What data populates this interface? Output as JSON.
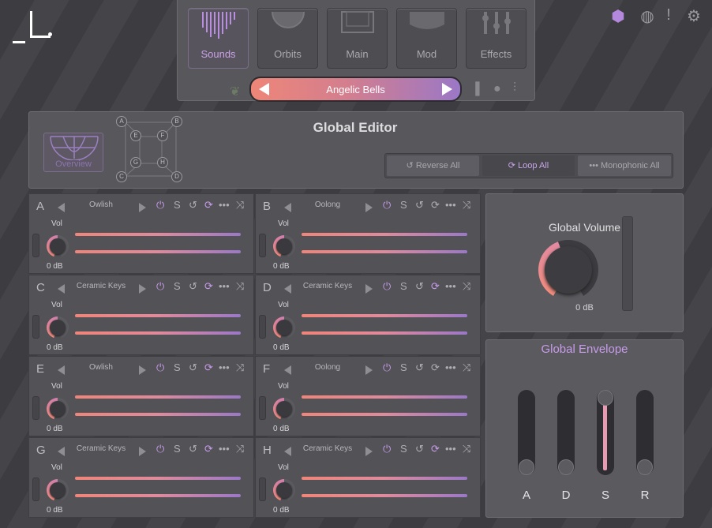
{
  "nav": {
    "tabs": [
      {
        "label": "Sounds",
        "active": true
      },
      {
        "label": "Orbits",
        "active": false
      },
      {
        "label": "Main",
        "active": false
      },
      {
        "label": "Mod",
        "active": false
      },
      {
        "label": "Effects",
        "active": false
      }
    ]
  },
  "preset": {
    "name": "Angelic Bells"
  },
  "top_icons": [
    "cube-icon",
    "globe-icon",
    "alert-icon",
    "gear-icon"
  ],
  "global_editor": {
    "title": "Global Editor",
    "overview_label": "Overview",
    "nodes": [
      "A",
      "B",
      "C",
      "D",
      "E",
      "F",
      "G",
      "H"
    ],
    "toggles": [
      {
        "label": "Reverse All",
        "active": false
      },
      {
        "label": "Loop All",
        "active": true
      },
      {
        "label": "Monophonic All",
        "active": false
      }
    ]
  },
  "slots": [
    {
      "letter": "A",
      "sound": "Owlish",
      "vol_label": "Vol",
      "db": "0 dB",
      "loop_on": true
    },
    {
      "letter": "B",
      "sound": "Oolong",
      "vol_label": "Vol",
      "db": "0 dB",
      "loop_on": false
    },
    {
      "letter": "C",
      "sound": "Ceramic Keys",
      "vol_label": "Vol",
      "db": "0 dB",
      "loop_on": true
    },
    {
      "letter": "D",
      "sound": "Ceramic Keys",
      "vol_label": "Vol",
      "db": "0 dB",
      "loop_on": true
    },
    {
      "letter": "E",
      "sound": "Owlish",
      "vol_label": "Vol",
      "db": "0 dB",
      "loop_on": true
    },
    {
      "letter": "F",
      "sound": "Oolong",
      "vol_label": "Vol",
      "db": "0 dB",
      "loop_on": false
    },
    {
      "letter": "G",
      "sound": "Ceramic Keys",
      "vol_label": "Vol",
      "db": "0 dB",
      "loop_on": true
    },
    {
      "letter": "H",
      "sound": "Ceramic Keys",
      "vol_label": "Vol",
      "db": "0 dB",
      "loop_on": true
    }
  ],
  "slot_buttons": {
    "solo": "S"
  },
  "global_volume": {
    "title": "Global Volume",
    "db": "0 dB"
  },
  "global_envelope": {
    "title": "Global Envelope",
    "faders": [
      {
        "label": "A",
        "level": 0.0
      },
      {
        "label": "D",
        "level": 0.0
      },
      {
        "label": "S",
        "level": 1.0
      },
      {
        "label": "R",
        "level": 0.0
      }
    ]
  },
  "colors": {
    "accent": "#c79bea",
    "gradient_start": "#ee8678",
    "gradient_end": "#9a78c6"
  }
}
